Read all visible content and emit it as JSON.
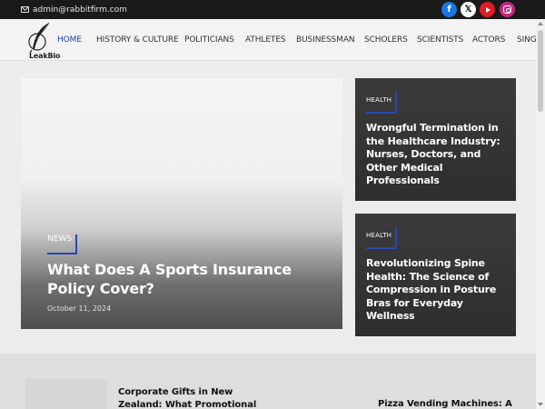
{
  "topbar": {
    "email": "admin@rabbitfirm.com",
    "social": [
      {
        "name": "facebook",
        "glyph": "f",
        "color": "#1b74e4"
      },
      {
        "name": "x",
        "glyph": "𝕏",
        "color": "#ffffff"
      },
      {
        "name": "youtube",
        "glyph": "",
        "color": "#e31b23"
      },
      {
        "name": "instagram",
        "glyph": "",
        "color": "#c3287f"
      }
    ]
  },
  "header": {
    "logo_text": "LeakBio",
    "nav": [
      "HOME",
      "HISTORY & CULTURE",
      "POLITICIANS",
      "ATHLETES",
      "BUSINESSMAN",
      "SCHOLERS",
      "SCIENTISTS",
      "ACTORS",
      "SINGERS"
    ],
    "active_nav": "HOME",
    "accent_color": "#1e3fa8"
  },
  "hero": {
    "category": "NEWS",
    "title": "What Does A Sports Insurance Policy Cover?",
    "date": "October 11, 2024"
  },
  "side_cards": [
    {
      "category": "HEALTH",
      "title": "Wrongful Termination in the Healthcare Industry: Nurses, Doctors, and Other Medical Professionals"
    },
    {
      "category": "HEALTH",
      "title": "Revolutionizing Spine Health: The Science of Compression in Posture Bras for Everyday Wellness"
    }
  ],
  "lower": {
    "post1_title": "Corporate Gifts in New Zealand: What Promotional",
    "post2_title": "Pizza Vending Machines: A"
  }
}
